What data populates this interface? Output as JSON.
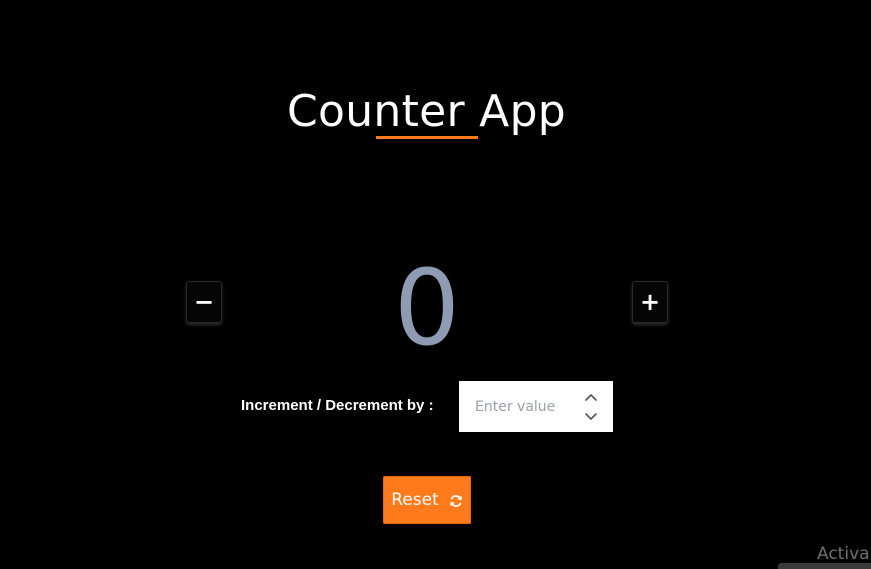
{
  "app": {
    "title": "Counter App",
    "accent_color": "#ff7a1a"
  },
  "counter": {
    "value": "0",
    "decrement_label": "−",
    "increment_label": "+"
  },
  "step": {
    "label": "Increment / Decrement by :",
    "placeholder": "Enter value",
    "value": ""
  },
  "reset": {
    "label": "Reset",
    "icon": "refresh-icon"
  },
  "overlay": {
    "watermark_text": "Activa"
  }
}
